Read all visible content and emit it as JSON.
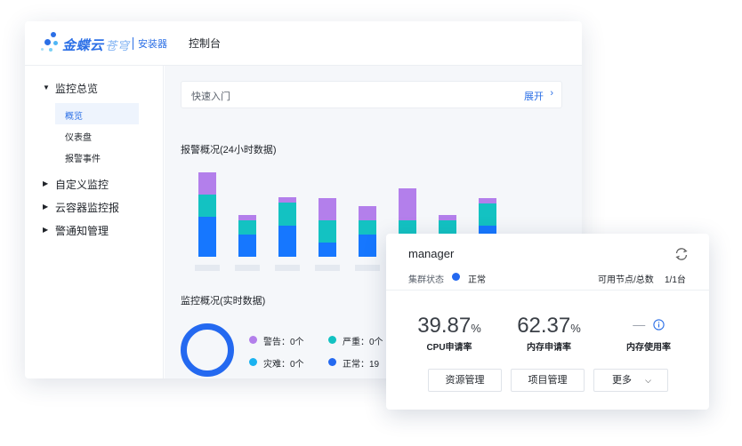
{
  "app": {
    "brand": "金蝶云",
    "brand_sub": "苍穹",
    "installer": "安装器",
    "console": "控制台"
  },
  "sidebar": {
    "groups": [
      {
        "label": "监控总览",
        "expanded": true,
        "children": [
          "概览",
          "仪表盘",
          "报警事件"
        ],
        "active_child": "概览"
      },
      {
        "label": "自定义监控",
        "expanded": false
      },
      {
        "label": "云容器监控报",
        "expanded": false
      },
      {
        "label": "警通知管理",
        "expanded": false
      }
    ]
  },
  "quick_entry": {
    "placeholder": "快速入门",
    "expand_label": "展开"
  },
  "alarm_section": {
    "title": "报警概况(24小时数据)"
  },
  "chart_data": {
    "type": "bar",
    "stacked": true,
    "categories": [
      "",
      "",
      "",
      "",
      "",
      "",
      "",
      "",
      ""
    ],
    "series": [
      {
        "color": "#1677ff",
        "values": [
          4.5,
          2.5,
          3.5,
          1.6,
          2.5,
          2.5,
          2.5,
          3.5,
          0.4
        ]
      },
      {
        "color": "#13c2c2",
        "values": [
          2.5,
          1.6,
          2.6,
          2.5,
          1.6,
          1.6,
          1.6,
          2.5,
          0.6
        ]
      },
      {
        "color": "#b37feb",
        "values": [
          2.5,
          0.6,
          0.6,
          2.5,
          1.6,
          3.6,
          0.6,
          0.6,
          1.6
        ]
      }
    ],
    "ylim": [
      0,
      10
    ],
    "grid": false,
    "legend": "none"
  },
  "monitor_section": {
    "title": "监控概况(实时数据)",
    "legend": [
      {
        "label": "警告：0个",
        "color": "#b37feb"
      },
      {
        "label": "严重：0个",
        "color": "#13c2c2"
      },
      {
        "label": "灾难：0个",
        "color": "#1ab2f0"
      },
      {
        "label": "正常：19",
        "color": "#2469f0"
      }
    ]
  },
  "card": {
    "title": "manager",
    "cluster_label": "集群状态",
    "cluster_status": "正常",
    "status_color": "#2469f0",
    "nodes_label": "可用节点/总数",
    "nodes_value": "1/1台",
    "metrics": [
      {
        "value": "39.87",
        "unit": "%",
        "label": "CPU申请率"
      },
      {
        "value": "62.37",
        "unit": "%",
        "label": "内存申请率"
      },
      {
        "value": "—",
        "unit": "",
        "label": "内存使用率"
      }
    ],
    "buttons": {
      "resource": "资源管理",
      "project": "项目管理",
      "more": "更多"
    }
  }
}
